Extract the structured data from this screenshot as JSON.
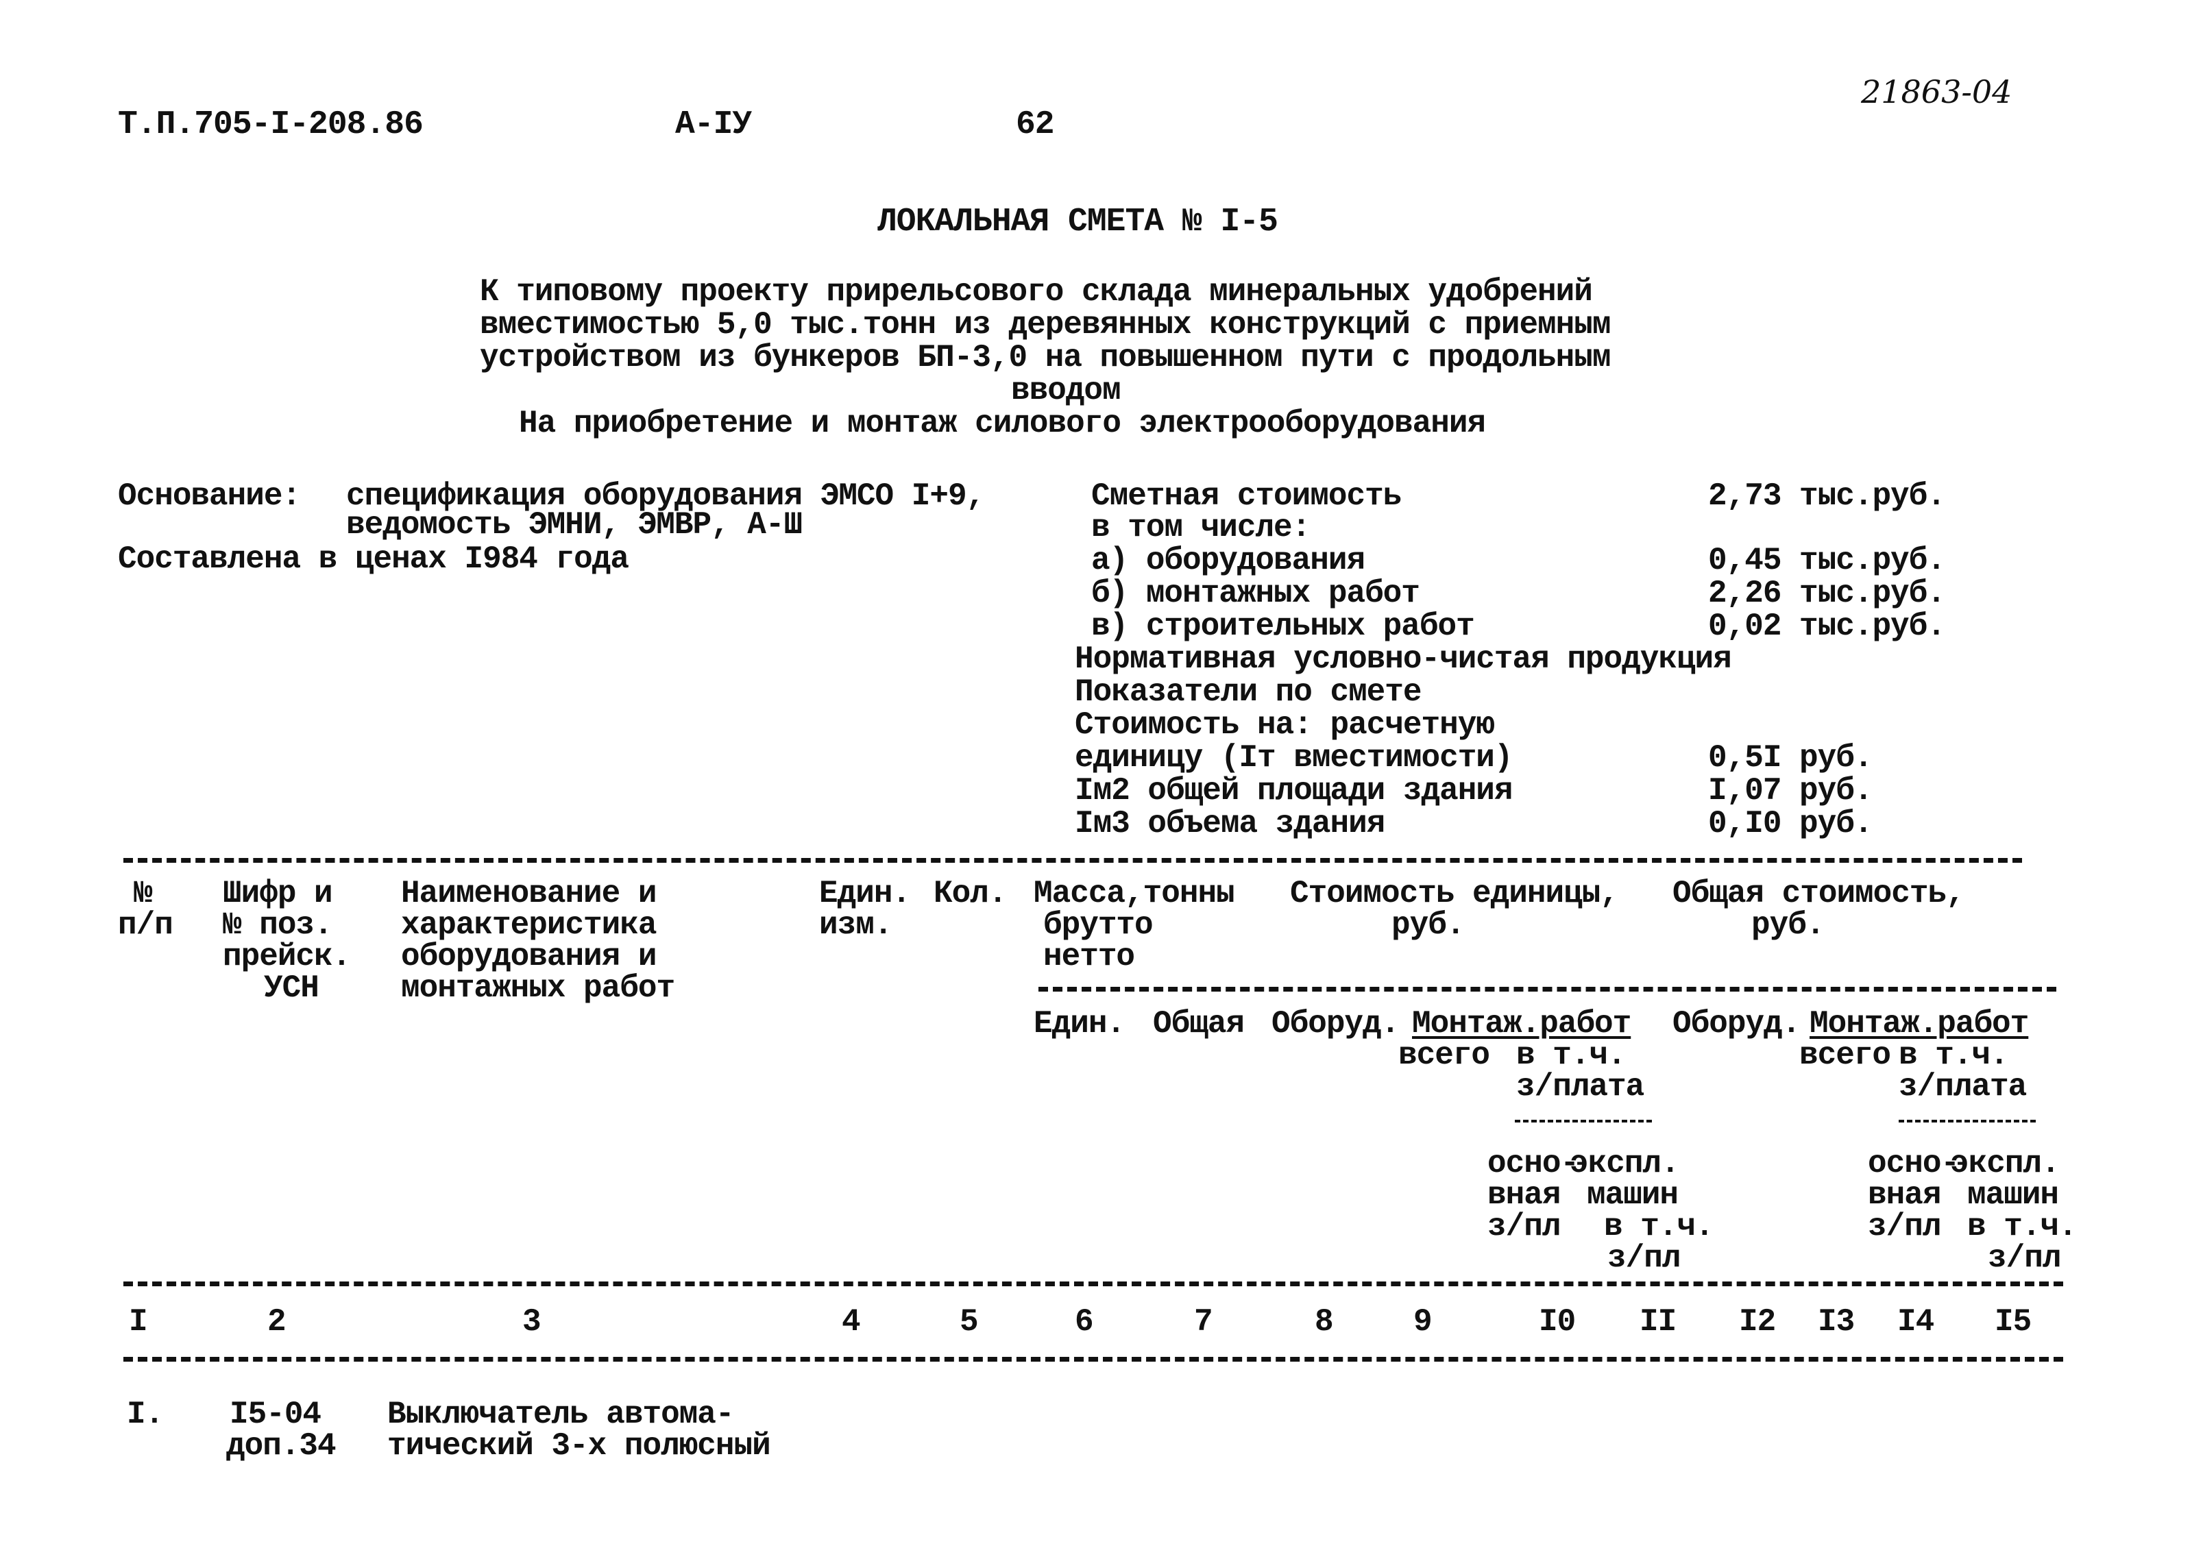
{
  "header": {
    "doc_code": "Т.П.705-I-208.86",
    "album": "А-IУ",
    "page_number": "62",
    "handwritten_number": "21863-04"
  },
  "title": "ЛОКАЛЬНАЯ СМЕТА № I-5",
  "subtitle_lines": [
    "К типовому проекту прирельсового склада минеральных удобрений",
    "вместимостью 5,0 тыс.тонн из деревянных конструкций с приемным",
    "устройством из бункеров БП-3,0 на повышенном пути с продольным",
    "вводом",
    "На приобретение и монтаж силового электрооборудования"
  ],
  "basis": {
    "label": "Основание:",
    "line1": "спецификация оборудования ЭМСО I+9,",
    "line2": "ведомость ЭМНИ, ЭМВР, А-Ш",
    "prices": "Составлена в ценах I984 года"
  },
  "costs": {
    "estimated_label": "Сметная стоимость",
    "estimated_value": "2,73 тыс.руб.",
    "including_label": "в том числе:",
    "items": [
      {
        "label": "а) оборудования",
        "value": "0,45 тыс.руб."
      },
      {
        "label": "б) монтажных работ",
        "value": "2,26 тыс.руб."
      },
      {
        "label": "в) строительных работ",
        "value": "0,02 тыс.руб."
      }
    ],
    "normative_label": "Нормативная условно-чистая продукция",
    "indicators_label": "Показатели по смете",
    "cost_per_label": "Стоимость на: расчетную",
    "per_items": [
      {
        "label": "единицу (Iт вместимости)",
        "value": "0,5I руб."
      },
      {
        "label": "Iм2 общей площади здания",
        "value": "I,07 руб."
      },
      {
        "label": "Iм3 объема здания",
        "value": "0,I0 руб."
      }
    ]
  },
  "table": {
    "headers": {
      "col1": [
        "№",
        "п/п"
      ],
      "col2": [
        "Шифр и",
        "№ поз.",
        "прейск.",
        "УСН"
      ],
      "col3": [
        "Наименование и",
        "характеристика",
        "оборудования и",
        "монтажных работ"
      ],
      "col4": [
        "Един.",
        "изм."
      ],
      "col5": "Кол.",
      "mass": [
        "Масса,тонны",
        "брутто",
        "нетто"
      ],
      "unit_cost": [
        "Стоимость единицы,",
        "руб."
      ],
      "total_cost": [
        "Общая стоимость,",
        "руб."
      ],
      "mass_sub": [
        "Един.",
        "Общая"
      ],
      "equip": "Оборуд.",
      "mount": "Монтаж.работ",
      "total_word": "всего",
      "incl": "в т.ч.",
      "wage": "з/плата",
      "base": [
        "осно-",
        "вная",
        "з/пл"
      ],
      "expl": [
        "экспл.",
        "машин"
      ],
      "incl_wage": [
        "в т.ч.",
        "з/пл"
      ]
    },
    "column_numbers": [
      "I",
      "2",
      "3",
      "4",
      "5",
      "6",
      "7",
      "8",
      "9",
      "I0",
      "II",
      "I2",
      "I3",
      "I4",
      "I5"
    ],
    "rows": [
      {
        "num": "I.",
        "code": [
          "I5-04",
          "доп.34"
        ],
        "name": [
          "Выключатель автома-",
          "тический 3-х полюсный"
        ]
      }
    ]
  }
}
